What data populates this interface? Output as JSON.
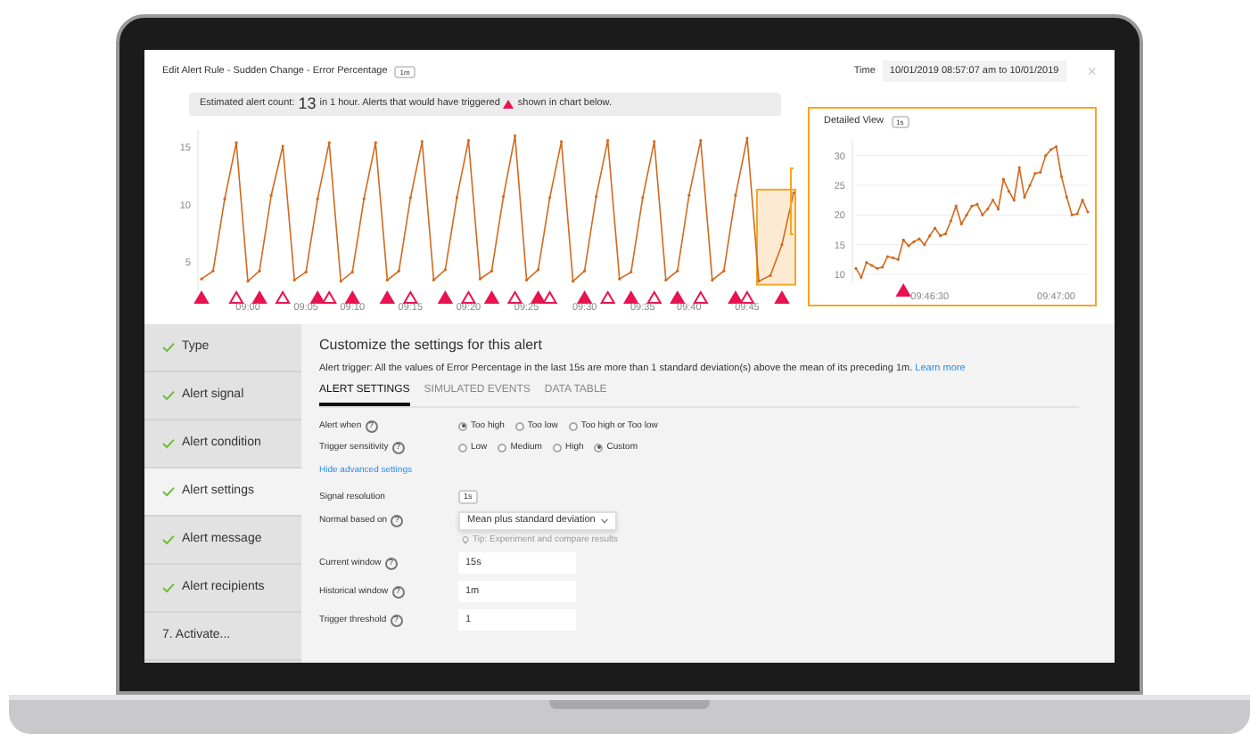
{
  "dialog": {
    "title": "Edit Alert Rule - Sudden Change - Error Percentage",
    "title_badge": "1m",
    "time_label": "Time",
    "time_value": "10/01/2019 08:57:07 am to 10/01/2019",
    "close": "×"
  },
  "estimate": {
    "before": "Estimated alert count:",
    "count": "13",
    "after": "in 1 hour. Alerts that would have triggered",
    "after2": "shown in chart below."
  },
  "main_chart": {
    "chart_data": {
      "type": "line",
      "categories": [
        null,
        null,
        null,
        null,
        "09:00",
        null,
        null,
        null,
        null,
        "09:05",
        null,
        null,
        null,
        "09:10",
        null,
        null,
        null,
        null,
        "09:15",
        null,
        null,
        null,
        null,
        "09:20",
        null,
        null,
        null,
        null,
        "09:25",
        null,
        null,
        null,
        null,
        "09:30",
        null,
        null,
        null,
        null,
        "09:35",
        null,
        null,
        null,
        "09:40",
        null,
        null,
        null,
        null,
        "09:45",
        null,
        null,
        null,
        null
      ],
      "series": [
        {
          "color": "#d2691e",
          "values": [
            3.5,
            4.2,
            10.5,
            15.4,
            3.3,
            4.2,
            10.8,
            15.1,
            3.4,
            4.1,
            10.5,
            15.4,
            3.3,
            4.1,
            10.5,
            15.4,
            3.4,
            4.2,
            10.6,
            15.5,
            3.4,
            4.3,
            10.6,
            15.6,
            3.5,
            4.2,
            10.7,
            16,
            3.4,
            4.3,
            10.6,
            15.5,
            3.3,
            4.2,
            10.7,
            15.6,
            3.5,
            4.1,
            10.6,
            15.5,
            3.4,
            4.2,
            10.8,
            15.6,
            3.4,
            4.2,
            10.8,
            15.8,
            3.3,
            3.8,
            6.5,
            11
          ]
        }
      ],
      "ylim": [
        2.5,
        16.5
      ],
      "yticks": [
        5,
        10,
        15
      ],
      "grid": false
    },
    "points": [
      {
        "alert": true,
        "filled": true
      },
      {
        "alert": false
      },
      {
        "alert": false
      },
      {
        "alert": true,
        "filled": false
      },
      {
        "alert": false
      },
      {
        "alert": true,
        "filled": true
      },
      {
        "alert": false
      },
      {
        "alert": true,
        "filled": false
      },
      {
        "alert": false
      },
      {
        "alert": false
      },
      {
        "alert": true,
        "filled": true
      },
      {
        "alert": true,
        "filled": false
      },
      {
        "alert": false
      },
      {
        "alert": true,
        "filled": true
      },
      {
        "alert": false
      },
      {
        "alert": false
      },
      {
        "alert": true,
        "filled": true
      },
      {
        "alert": false
      },
      {
        "alert": true,
        "filled": false
      },
      {
        "alert": false
      },
      {
        "alert": false
      },
      {
        "alert": true,
        "filled": true
      },
      {
        "alert": false
      },
      {
        "alert": true,
        "filled": false
      },
      {
        "alert": false
      },
      {
        "alert": true,
        "filled": true
      },
      {
        "alert": false
      },
      {
        "alert": true,
        "filled": false
      },
      {
        "alert": false
      },
      {
        "alert": true,
        "filled": true
      },
      {
        "alert": true,
        "filled": false
      },
      {
        "alert": false
      },
      {
        "alert": false
      },
      {
        "alert": true,
        "filled": true
      },
      {
        "alert": false
      },
      {
        "alert": true,
        "filled": false
      },
      {
        "alert": false
      },
      {
        "alert": true,
        "filled": true
      },
      {
        "alert": false
      },
      {
        "alert": true,
        "filled": false
      },
      {
        "alert": false
      },
      {
        "alert": true,
        "filled": true
      },
      {
        "alert": false
      },
      {
        "alert": true,
        "filled": false
      },
      {
        "alert": false
      },
      {
        "alert": false
      },
      {
        "alert": true,
        "filled": true
      },
      {
        "alert": true,
        "filled": false
      },
      {
        "alert": false
      },
      {
        "alert": false
      },
      {
        "alert": true,
        "filled": true
      },
      {
        "alert": false
      }
    ]
  },
  "detail_chart": {
    "title": "Detailed View",
    "badge": "1s",
    "chart_data": {
      "type": "line",
      "categories": [
        null,
        null,
        null,
        null,
        null,
        null,
        null,
        null,
        null,
        null,
        null,
        null,
        null,
        null,
        "09:46:30",
        null,
        null,
        null,
        null,
        null,
        null,
        null,
        null,
        null,
        null,
        null,
        null,
        null,
        null,
        null,
        null,
        null,
        null,
        null,
        null,
        null,
        null,
        null,
        "09:47:00",
        null,
        null,
        null,
        null,
        null,
        null
      ],
      "series": [
        {
          "color": "#d2691e",
          "values": [
            11,
            9.5,
            12,
            11.5,
            11,
            11.2,
            13,
            12.8,
            12.5,
            15.8,
            14.8,
            15.5,
            16,
            15,
            16.5,
            17.8,
            16.5,
            16.8,
            19,
            21.5,
            18.5,
            20,
            21.5,
            21.8,
            20,
            21,
            22.5,
            21,
            26,
            24,
            22.5,
            28,
            23,
            25,
            27,
            27.2,
            30,
            31,
            31.5,
            26.5,
            23,
            20,
            20.2,
            22.5,
            20.5
          ]
        }
      ],
      "ylim": [
        8.5,
        32.5
      ],
      "yticks": [
        10,
        15,
        20,
        25,
        30
      ],
      "grid": true
    },
    "points": [
      {
        "alert": false
      },
      {
        "alert": false
      },
      {
        "alert": false
      },
      {
        "alert": false
      },
      {
        "alert": false
      },
      {
        "alert": false
      },
      {
        "alert": false
      },
      {
        "alert": false
      },
      {
        "alert": false
      },
      {
        "alert": true,
        "filled": true
      },
      {
        "alert": false
      },
      {
        "alert": false
      },
      {
        "alert": false
      },
      {
        "alert": false
      },
      {
        "alert": false
      },
      {
        "alert": false
      },
      {
        "alert": false
      },
      {
        "alert": false
      },
      {
        "alert": false
      },
      {
        "alert": false
      },
      {
        "alert": false
      },
      {
        "alert": false
      },
      {
        "alert": false
      },
      {
        "alert": false
      },
      {
        "alert": false
      },
      {
        "alert": false
      },
      {
        "alert": false
      },
      {
        "alert": false
      },
      {
        "alert": false
      },
      {
        "alert": false
      },
      {
        "alert": false
      },
      {
        "alert": false
      },
      {
        "alert": false
      },
      {
        "alert": false
      },
      {
        "alert": false
      },
      {
        "alert": false
      },
      {
        "alert": false
      },
      {
        "alert": false
      },
      {
        "alert": false
      },
      {
        "alert": false
      },
      {
        "alert": false
      },
      {
        "alert": false
      },
      {
        "alert": false
      },
      {
        "alert": false
      },
      {
        "alert": false
      }
    ]
  },
  "steps": [
    {
      "label": "Type",
      "done": true,
      "selected": false
    },
    {
      "label": "Alert signal",
      "done": true,
      "selected": false
    },
    {
      "label": "Alert condition",
      "done": true,
      "selected": false
    },
    {
      "label": "Alert settings",
      "done": true,
      "selected": true
    },
    {
      "label": "Alert message",
      "done": true,
      "selected": false
    },
    {
      "label": "Alert recipients",
      "done": true,
      "selected": false
    },
    {
      "label": "7.  Activate...",
      "done": false,
      "selected": false
    }
  ],
  "settings": {
    "heading": "Customize the settings for this alert",
    "trigger": "Alert trigger: All the values of Error Percentage in the last 15s are more than 1 standard deviation(s) above the mean of its preceding 1m.",
    "learn_more": "Learn more",
    "tabs": [
      {
        "label": "ALERT SETTINGS",
        "selected": true
      },
      {
        "label": "SIMULATED EVENTS",
        "selected": false
      },
      {
        "label": "DATA TABLE",
        "selected": false
      }
    ],
    "rows": [
      {
        "kind": "radio",
        "label": "Alert when",
        "help": "?",
        "options": [
          {
            "label": "Too high",
            "selected": true
          },
          {
            "label": "Too low",
            "selected": false
          },
          {
            "label": "Too high or Too low",
            "selected": false
          }
        ]
      },
      {
        "kind": "radio",
        "label": "Trigger sensitivity",
        "help": "?",
        "options": [
          {
            "label": "Low",
            "selected": false
          },
          {
            "label": "Medium",
            "selected": false
          },
          {
            "label": "High",
            "selected": false
          },
          {
            "label": "Custom",
            "selected": true
          }
        ]
      },
      {
        "kind": "link",
        "label": "Hide advanced settings"
      },
      {
        "kind": "badge",
        "label": "Signal resolution",
        "value": "1s"
      },
      {
        "kind": "select",
        "label": "Normal based on",
        "help": "?",
        "value": "Mean plus standard deviation",
        "tip": "Tip: Experiment and compare results"
      },
      {
        "kind": "input",
        "label": "Current window",
        "help": "?",
        "value": "15s"
      },
      {
        "kind": "input",
        "label": "Historical window",
        "help": "?",
        "value": "1m"
      },
      {
        "kind": "input",
        "label": "Trigger threshold",
        "help": "?",
        "value": "1"
      }
    ]
  }
}
